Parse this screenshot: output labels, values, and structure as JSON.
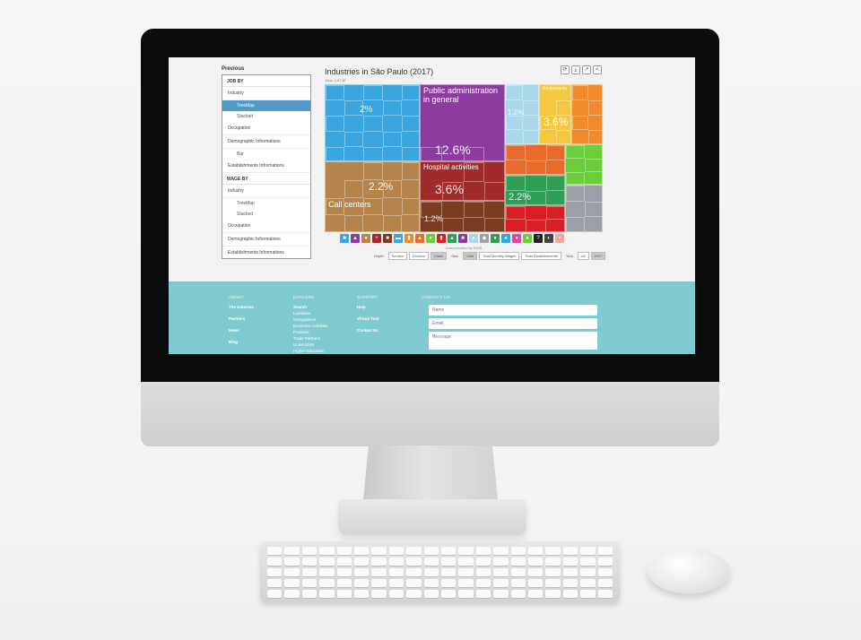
{
  "sidebar": {
    "title": "Previous",
    "sections": [
      {
        "heading": "JOB BY",
        "items": [
          {
            "label": "Industry",
            "subs": [
              {
                "label": "TreeMap",
                "active": true
              },
              {
                "label": "Stacked",
                "active": false
              }
            ]
          },
          {
            "label": "Occupation",
            "subs": []
          },
          {
            "label": "Demographic Informations",
            "subs": [
              {
                "label": "Bar",
                "active": false
              }
            ]
          },
          {
            "label": "Establishments Informations",
            "subs": []
          }
        ]
      },
      {
        "heading": "WAGE BY",
        "items": [
          {
            "label": "Industry",
            "subs": [
              {
                "label": "TreeMap",
                "active": false
              },
              {
                "label": "Stacked",
                "active": false
              }
            ]
          },
          {
            "label": "Occupation",
            "subs": []
          },
          {
            "label": "Demographic Informations",
            "subs": []
          },
          {
            "label": "Establishments Informations",
            "subs": []
          }
        ]
      }
    ]
  },
  "main": {
    "title": "Industries in São Paulo (2017)",
    "subtitle": "Jobs: 4.07 M",
    "toolbar": [
      {
        "name": "refresh-button",
        "icon": "⟳"
      },
      {
        "name": "download-button",
        "icon": "⤓"
      },
      {
        "name": "share-button",
        "icon": "↗"
      },
      {
        "name": "embed-button",
        "icon": "<"
      }
    ]
  },
  "chart_data": {
    "type": "treemap",
    "title": "Industries in São Paulo (2017)",
    "tiles": [
      {
        "color": "#3aa6e0",
        "label": "",
        "pct": "2%"
      },
      {
        "color": "#8c3b9e",
        "label": "Public administration in general",
        "pct": "12.6%"
      },
      {
        "color": "#a8d8ea",
        "label": "",
        "pct": "1.2%"
      },
      {
        "color": "#f6c842",
        "label": "Restaurants",
        "pct": "3.6%"
      },
      {
        "color": "#f08a2c",
        "label": "",
        "pct": ""
      },
      {
        "color": "#b5844a",
        "label": "Call centers",
        "pct": "2.2%"
      },
      {
        "color": "#a12a2a",
        "label": "Hospital activities",
        "pct": "3.6%"
      },
      {
        "color": "#e96b2b",
        "label": "",
        "pct": ""
      },
      {
        "color": "#6ccd3c",
        "label": "",
        "pct": ""
      },
      {
        "color": "#2f9e57",
        "label": "",
        "pct": "2.2%"
      },
      {
        "color": "#d81f26",
        "label": "",
        "pct": ""
      },
      {
        "color": "#9aa0a6",
        "label": "",
        "pct": ""
      },
      {
        "color": "#7a3d22",
        "label": "",
        "pct": "1.2%"
      }
    ]
  },
  "icons": [
    {
      "name": "construction-icon",
      "color": "#3aa6e0",
      "glyph": "■"
    },
    {
      "name": "agriculture-icon",
      "color": "#8c3b9e",
      "glyph": "▲"
    },
    {
      "name": "trade-icon",
      "color": "#b5844a",
      "glyph": "●"
    },
    {
      "name": "health-icon",
      "color": "#a12a2a",
      "glyph": "+"
    },
    {
      "name": "services-icon",
      "color": "#7a3d22",
      "glyph": "■"
    },
    {
      "name": "transport-icon",
      "color": "#3aa6e0",
      "glyph": "▬"
    },
    {
      "name": "industry-icon",
      "color": "#f08a2c",
      "glyph": "▮"
    },
    {
      "name": "education-icon",
      "color": "#e96b2b",
      "glyph": "▲"
    },
    {
      "name": "finance-icon",
      "color": "#6ccd3c",
      "glyph": "●"
    },
    {
      "name": "utilities-icon",
      "color": "#d81f26",
      "glyph": "▮"
    },
    {
      "name": "research-icon",
      "color": "#2f9e57",
      "glyph": "▲"
    },
    {
      "name": "admin-icon",
      "color": "#8c3b9e",
      "glyph": "■"
    },
    {
      "name": "leisure-icon",
      "color": "#a8d8ea",
      "glyph": "●"
    },
    {
      "name": "mining-icon",
      "color": "#9aa0a6",
      "glyph": "◆"
    },
    {
      "name": "energy-icon",
      "color": "#2f9e57",
      "glyph": "●"
    },
    {
      "name": "water-icon",
      "color": "#3aa6e0",
      "glyph": "●"
    },
    {
      "name": "food-icon",
      "color": "#e0479e",
      "glyph": "●"
    },
    {
      "name": "household-icon",
      "color": "#6ccd3c",
      "glyph": "●"
    },
    {
      "name": "organization-icon",
      "color": "#222222",
      "glyph": "?"
    },
    {
      "name": "tourism-icon",
      "color": "#444444",
      "glyph": "◐"
    },
    {
      "name": "other-icon",
      "color": "#f2a7a0",
      "glyph": "▪"
    }
  ],
  "data_source": "Data provided by RAIS",
  "controls": {
    "depth_label": "Depth",
    "depth_options": [
      {
        "label": "Section",
        "on": false
      },
      {
        "label": "Division",
        "on": false
      },
      {
        "label": "Class",
        "on": true
      }
    ],
    "size_label": "Size",
    "size_options": [
      {
        "label": "Jobs",
        "on": true
      },
      {
        "label": "Total Monthly Wages",
        "on": false
      },
      {
        "label": "Total Establishments",
        "on": false
      }
    ],
    "year_label": "Year",
    "year_options": [
      {
        "label": "All",
        "on": false
      },
      {
        "label": "2017",
        "on": true
      }
    ]
  },
  "footer": {
    "about_heading": "ABOUT",
    "about_links": [
      "The Dataviva",
      "Partners",
      "News",
      "Blog"
    ],
    "explore_heading": "EXPLORE",
    "explore_links": [
      "Search",
      "Locations",
      "Occupations",
      "Economic Activities",
      "Products",
      "Trade Partners",
      "Universities",
      "Higher Education"
    ],
    "support_heading": "SUPPORT",
    "support_links": [
      "Help",
      "Virtual Tour",
      "Contact Us"
    ],
    "contact_heading": "CONTACT US",
    "name_placeholder": "Name",
    "email_placeholder": "Email",
    "message_placeholder": "Message"
  }
}
